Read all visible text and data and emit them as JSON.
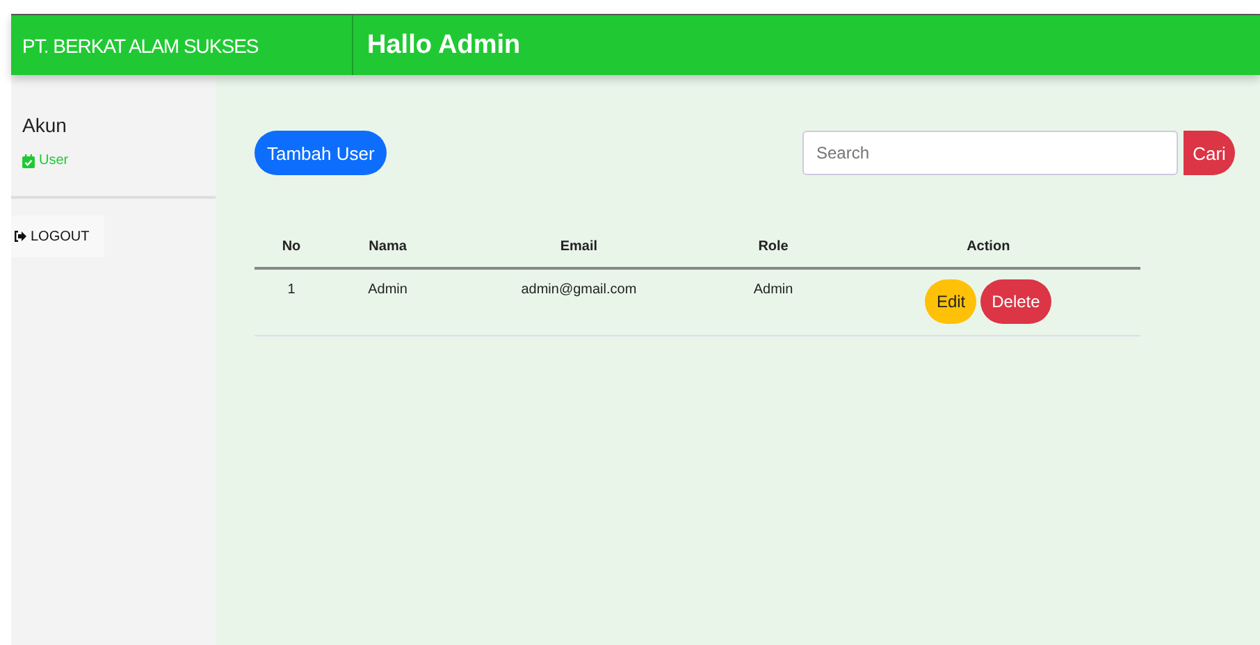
{
  "brand": "PT. BERKAT ALAM SUKSES",
  "greeting": "Hallo Admin",
  "sidebar": {
    "title": "Akun",
    "items": [
      {
        "label": "User",
        "selected": true
      }
    ],
    "logout": "LOGOUT"
  },
  "add_button": "Tambah User",
  "search": {
    "placeholder": "Search",
    "button": "Cari"
  },
  "table": {
    "columns": [
      "No",
      "Nama",
      "Email",
      "Role",
      "Action"
    ],
    "rows": [
      {
        "cells": [
          "1",
          "Admin",
          "admin@gmail.com",
          "Admin"
        ],
        "actions": [
          "Edit",
          "Delete"
        ]
      }
    ]
  }
}
